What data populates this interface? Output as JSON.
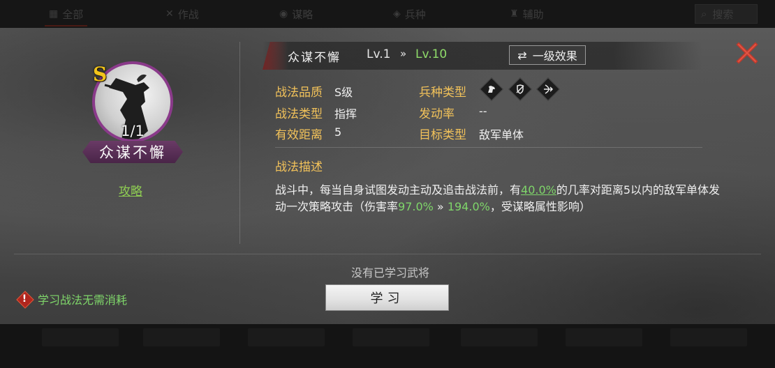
{
  "topbar": {
    "tabs": [
      {
        "label": "全部",
        "icon": "grid-icon"
      },
      {
        "label": "作战",
        "icon": "swords-icon"
      },
      {
        "label": "谋略",
        "icon": "scroll-icon"
      },
      {
        "label": "兵种",
        "icon": "troop-icon"
      },
      {
        "label": "辅助",
        "icon": "support-icon"
      }
    ],
    "search_label": "搜索"
  },
  "tactic": {
    "grade": "S",
    "count": "1/1",
    "name": "众谋不懈",
    "guide_link": "攻略",
    "level_from": "Lv.1",
    "level_arrow": "»",
    "level_to": "Lv.10",
    "effect_button": "一级效果"
  },
  "attributes": {
    "quality_label": "战法品质",
    "quality_value": "S级",
    "type_label": "战法类型",
    "type_value": "指挥",
    "range_label": "有效距离",
    "range_value": "5",
    "troop_label": "兵种类型",
    "rate_label": "发动率",
    "rate_value": "--",
    "target_label": "目标类型",
    "target_value": "敌军单体",
    "troop_icons": [
      "cavalry-icon",
      "shield-infantry-icon",
      "archer-icon"
    ]
  },
  "description": {
    "title": "战法描述",
    "part1": "战斗中，每当自身试图发动主动及追击战法前，有",
    "chance": "40.0%",
    "part2": "的几率对距离5以内的敌军单体发动一次策略攻击（伤害率",
    "dmg_from": "97.0%",
    "arrow": " » ",
    "dmg_to": "194.0%",
    "part3": "，受谋略属性影响）"
  },
  "footer": {
    "no_general": "没有已学习武将",
    "learn_button": "学习",
    "tip": "学习战法无需消耗"
  },
  "colors": {
    "accent_gold": "#f2c25a",
    "accent_green": "#7fd66a",
    "grade_purple": "#8a3a8a",
    "close_red": "#c0392b"
  }
}
